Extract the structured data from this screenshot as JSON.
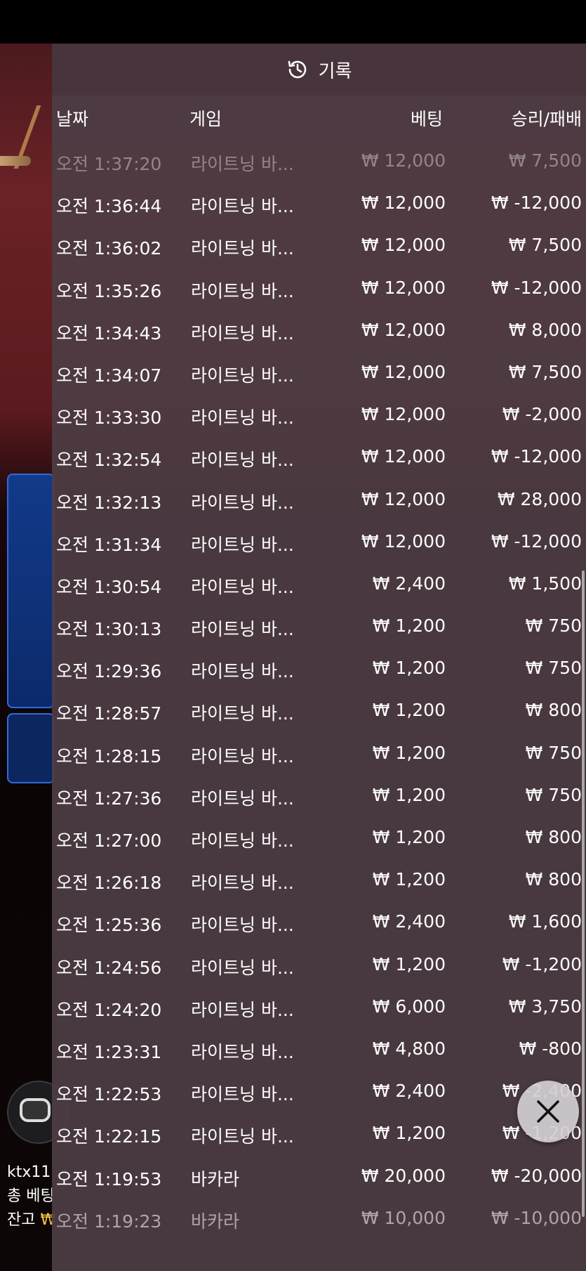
{
  "panel": {
    "title": "기록",
    "icon": "history-icon",
    "columns": {
      "date": "날짜",
      "game": "게임",
      "bet": "베팅",
      "win_loss": "승리/패배"
    },
    "rows": [
      {
        "date": "오전 1:37:20",
        "game": "라이트닝 바...",
        "bet": "₩ 12,000",
        "result": "₩ 7,500"
      },
      {
        "date": "오전 1:36:44",
        "game": "라이트닝 바...",
        "bet": "₩ 12,000",
        "result": "₩ -12,000"
      },
      {
        "date": "오전 1:36:02",
        "game": "라이트닝 바...",
        "bet": "₩ 12,000",
        "result": "₩ 7,500"
      },
      {
        "date": "오전 1:35:26",
        "game": "라이트닝 바...",
        "bet": "₩ 12,000",
        "result": "₩ -12,000"
      },
      {
        "date": "오전 1:34:43",
        "game": "라이트닝 바...",
        "bet": "₩ 12,000",
        "result": "₩ 8,000"
      },
      {
        "date": "오전 1:34:07",
        "game": "라이트닝 바...",
        "bet": "₩ 12,000",
        "result": "₩ 7,500"
      },
      {
        "date": "오전 1:33:30",
        "game": "라이트닝 바...",
        "bet": "₩ 12,000",
        "result": "₩ -2,000"
      },
      {
        "date": "오전 1:32:54",
        "game": "라이트닝 바...",
        "bet": "₩ 12,000",
        "result": "₩ -12,000"
      },
      {
        "date": "오전 1:32:13",
        "game": "라이트닝 바...",
        "bet": "₩ 12,000",
        "result": "₩ 28,000"
      },
      {
        "date": "오전 1:31:34",
        "game": "라이트닝 바...",
        "bet": "₩ 12,000",
        "result": "₩ -12,000"
      },
      {
        "date": "오전 1:30:54",
        "game": "라이트닝 바...",
        "bet": "₩ 2,400",
        "result": "₩ 1,500"
      },
      {
        "date": "오전 1:30:13",
        "game": "라이트닝 바...",
        "bet": "₩ 1,200",
        "result": "₩ 750"
      },
      {
        "date": "오전 1:29:36",
        "game": "라이트닝 바...",
        "bet": "₩ 1,200",
        "result": "₩ 750"
      },
      {
        "date": "오전 1:28:57",
        "game": "라이트닝 바...",
        "bet": "₩ 1,200",
        "result": "₩ 800"
      },
      {
        "date": "오전 1:28:15",
        "game": "라이트닝 바...",
        "bet": "₩ 1,200",
        "result": "₩ 750"
      },
      {
        "date": "오전 1:27:36",
        "game": "라이트닝 바...",
        "bet": "₩ 1,200",
        "result": "₩ 750"
      },
      {
        "date": "오전 1:27:00",
        "game": "라이트닝 바...",
        "bet": "₩ 1,200",
        "result": "₩ 800"
      },
      {
        "date": "오전 1:26:18",
        "game": "라이트닝 바...",
        "bet": "₩ 1,200",
        "result": "₩ 800"
      },
      {
        "date": "오전 1:25:36",
        "game": "라이트닝 바...",
        "bet": "₩ 2,400",
        "result": "₩ 1,600"
      },
      {
        "date": "오전 1:24:56",
        "game": "라이트닝 바...",
        "bet": "₩ 1,200",
        "result": "₩ -1,200"
      },
      {
        "date": "오전 1:24:20",
        "game": "라이트닝 바...",
        "bet": "₩ 6,000",
        "result": "₩ 3,750"
      },
      {
        "date": "오전 1:23:31",
        "game": "라이트닝 바...",
        "bet": "₩ 4,800",
        "result": "₩ -800"
      },
      {
        "date": "오전 1:22:53",
        "game": "라이트닝 바...",
        "bet": "₩ 2,400",
        "result": "₩ -2,400"
      },
      {
        "date": "오전 1:22:15",
        "game": "라이트닝 바...",
        "bet": "₩ 1,200",
        "result": "₩ -1,200"
      },
      {
        "date": "오전 1:19:53",
        "game": "바카라",
        "bet": "₩ 20,000",
        "result": "₩ -20,000"
      },
      {
        "date": "오전 1:19:23",
        "game": "바카라",
        "bet": "₩ 10,000",
        "result": "₩ -10,000"
      }
    ]
  },
  "background": {
    "user": "ktx11",
    "total_bet_label": "총 베팅",
    "balance_label": "잔고",
    "balance_currency": "₩"
  },
  "colors": {
    "accent_gold": "#f5c542",
    "panel_bg": "#4e3c44",
    "blue_panel": "#2f6bd8"
  },
  "close_button": {
    "icon": "close-icon"
  }
}
